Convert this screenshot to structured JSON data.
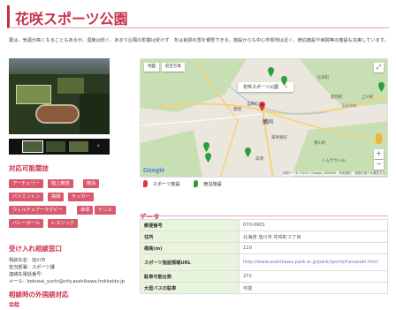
{
  "page": {
    "title": "花咲スポーツ公園",
    "description": "夏は、気温が高くなることもあるが、湿度は低く、あまり台風の影響は受けず　冬は良質の雪を積雪できる。施設からも中心市街地は近く、宿泊施設や病院等の施設も充実しています。"
  },
  "photo": {
    "alt": "aerial-stadium-photo",
    "thumb_count": 3
  },
  "sports": {
    "heading": "対応可能競技",
    "tags": [
      "アーチェリー",
      "陸上競技",
      "競泳",
      "バドミントン",
      "高跳",
      "サッカー",
      "ウィルチェアーラグビー",
      "卓球",
      "テニス",
      "バレーボール",
      "レスリング"
    ]
  },
  "contact": {
    "heading": "受け入れ相談窓口",
    "lines": [
      "相談先名：旭川市",
      "担当部署：スポーツ課",
      "連絡先電話番号：",
      "メール：kokusai_yuchi@city.asahikawa.hokkaido.jp"
    ]
  },
  "languages": {
    "heading": "相談時の外国語対応",
    "first_line": "会話"
  },
  "map": {
    "tab_map": "地図",
    "tab_satellite": "航空写真",
    "tooltip": "花咲スポーツ公園",
    "google_logo": "Google",
    "attribution": "地図データ ©2017 Google, ZENRIN　利用規約　地図の誤りを報告する",
    "labels": [
      "当麻町",
      "比布町",
      "愛別町",
      "上川町",
      "石北本線",
      "旭川",
      "東神楽町",
      "東川町",
      "美瑛",
      "トムラウシ山",
      "鷹栖"
    ],
    "colors": {
      "sports_pin": "#d9393a",
      "lodging_pin": "#2e9e3b",
      "road": "#f6d37a",
      "green": "#c7dfb3"
    }
  },
  "legend": {
    "sports": "スポーツ施設",
    "lodging": "宿泊施設"
  },
  "data": {
    "heading": "データ",
    "rows": [
      {
        "key": "郵便番号",
        "value": "070-0901"
      },
      {
        "key": "住所",
        "value": "北海道 旭川市 花咲町３丁目"
      },
      {
        "key": "標高(m)",
        "value": "110"
      },
      {
        "key": "スポーツ施設情報URL",
        "value": "http://www.asahikawa.park.or.jp/park/sports/hanasaki.html"
      },
      {
        "key": "駐車可能台数",
        "value": "272"
      },
      {
        "key": "大型バスの駐車",
        "value": "可能"
      }
    ]
  }
}
